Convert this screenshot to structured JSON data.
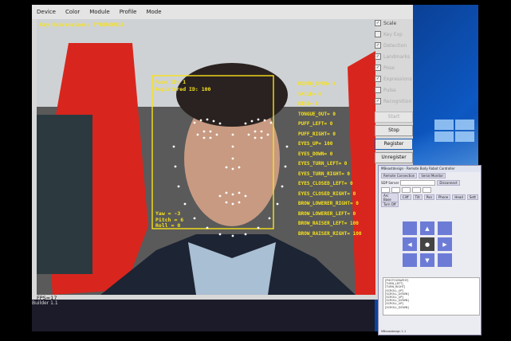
{
  "menu": [
    "Device",
    "Color",
    "Module",
    "Profile",
    "Mode"
  ],
  "overlay": {
    "key_expression": "Key Expressions: EYEBROWS10",
    "face_id": "Face ID: 1",
    "registered_id": "Registered ID: 100",
    "pose": "Yaw = -3\nPitch = 6\nRoll = 0",
    "expressions": "MOUTH_OPEN= 0\nSMILE= 0\nKISS= 0\nTONGUE_OUT= 0\nPUFF_LEFT= 0\nPUFF_RIGHT= 0\nEYES_UP= 100\nEYES_DOWN= 0\nEYES_TURN_LEFT= 0\nEYES_TURN_RIGHT= 0\nEYES_CLOSED_LEFT= 0\nEYES_CLOSED_RIGHT= 0\nBROW_LOWERER_RIGHT= 0\nBROW_LOWERER_LEFT= 0\nBROW_RAISER_LEFT= 100\nBROW_RAISER_RIGHT= 100"
  },
  "status": {
    "fps": "FPS=17",
    "build": "Builder 1.1"
  },
  "options": [
    {
      "label": "Scale",
      "checked": true,
      "enabled": true
    },
    {
      "label": "Key Exp",
      "checked": false,
      "enabled": false
    },
    {
      "label": "Detection",
      "checked": true,
      "enabled": false
    },
    {
      "label": "Landmarks",
      "checked": true,
      "enabled": false
    },
    {
      "label": "Pose",
      "checked": true,
      "enabled": false
    },
    {
      "label": "Expressions",
      "checked": true,
      "enabled": false
    },
    {
      "label": "Pulse",
      "checked": false,
      "enabled": false
    },
    {
      "label": "Recognition",
      "checked": true,
      "enabled": false
    }
  ],
  "buttons": {
    "start": "Start",
    "stop": "Stop",
    "register": "Register",
    "unregister": "Unregister"
  },
  "remote": {
    "title": "MBeastdesign - Remote Body Robot Controller",
    "tabs": [
      "Remote Connection",
      "Serial Monitor"
    ],
    "ip_label": "SDP Server",
    "disconnect": "Disconnect",
    "ctrl_tabs": [
      "Arc Base",
      "Cliff",
      "Tilt",
      "Pan",
      "Phone",
      "Head",
      "Sett"
    ],
    "turn_off": "Turn Off",
    "log": "[PHOTOGRAPHY]\n[TURN_LEFT]\n[TURN_RIGHT]\n[SCROLL_UP]\n[SCROLL_DOWN]\n[SCROLL_UP]\n[SCROLL_DOWN]\n[SCROLL_UP]\n[SCROLL_DOWN]",
    "foot": "MBeastdesign 1.1"
  },
  "colors": {
    "overlay": "#f7e21a",
    "landmarks": "#ffffff"
  }
}
